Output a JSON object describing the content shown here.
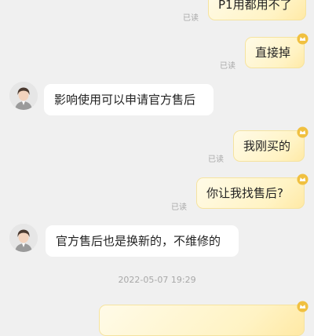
{
  "messages": [
    {
      "text": "P1用都用不了",
      "read": "已读"
    },
    {
      "text": "直接掉",
      "read": "已读"
    },
    {
      "text": "影响使用可以申请官方售后"
    },
    {
      "text": "我刚买的",
      "read": "已读"
    },
    {
      "text": "你让我找售后?",
      "read": "已读"
    },
    {
      "text": "官方售后也是换新的，不维修的"
    }
  ],
  "timestamp": "2022-05-07 19:29",
  "colors": {
    "background": "#f0f0f0",
    "outgoing_bubble": "#fff3c4",
    "incoming_bubble": "#ffffff",
    "badge": "#f0c040",
    "read_text": "#a8a8a8"
  },
  "icons": {
    "badge": "gold-member-icon",
    "avatar": "service-agent-avatar"
  }
}
